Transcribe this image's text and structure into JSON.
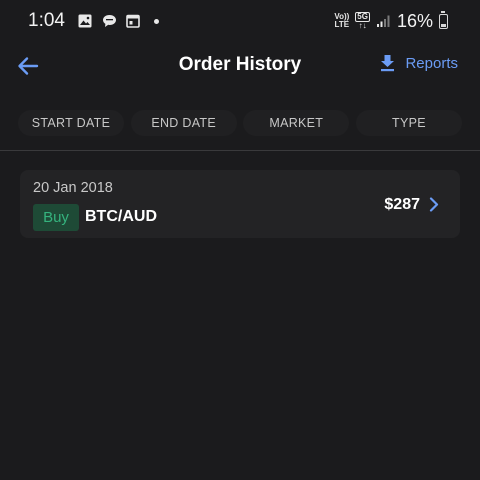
{
  "status_bar": {
    "time": "1:04",
    "lte_top": "Vo))",
    "lte_bottom": "LTE",
    "net_top": "5G",
    "net_bottom": "↑↓",
    "battery": "16%",
    "icons": [
      "image-icon",
      "chat-bubble-icon",
      "calendar-icon",
      "notification-dot",
      "signal-icon",
      "battery-icon"
    ]
  },
  "header": {
    "title": "Order History",
    "reports_label": "Reports",
    "back_icon": "arrow-left-icon",
    "reports_icon": "download-icon"
  },
  "filters": {
    "start_date": "START DATE",
    "end_date": "END DATE",
    "market": "MARKET",
    "type": "TYPE"
  },
  "orders": [
    {
      "date": "20 Jan 2018",
      "side": "Buy",
      "market": "BTC/AUD",
      "amount": "$287"
    }
  ],
  "colors": {
    "background": "#1b1b1d",
    "accent": "#6b9cf5",
    "buy_text": "#35b37e",
    "buy_bg": "#1e4a36"
  }
}
